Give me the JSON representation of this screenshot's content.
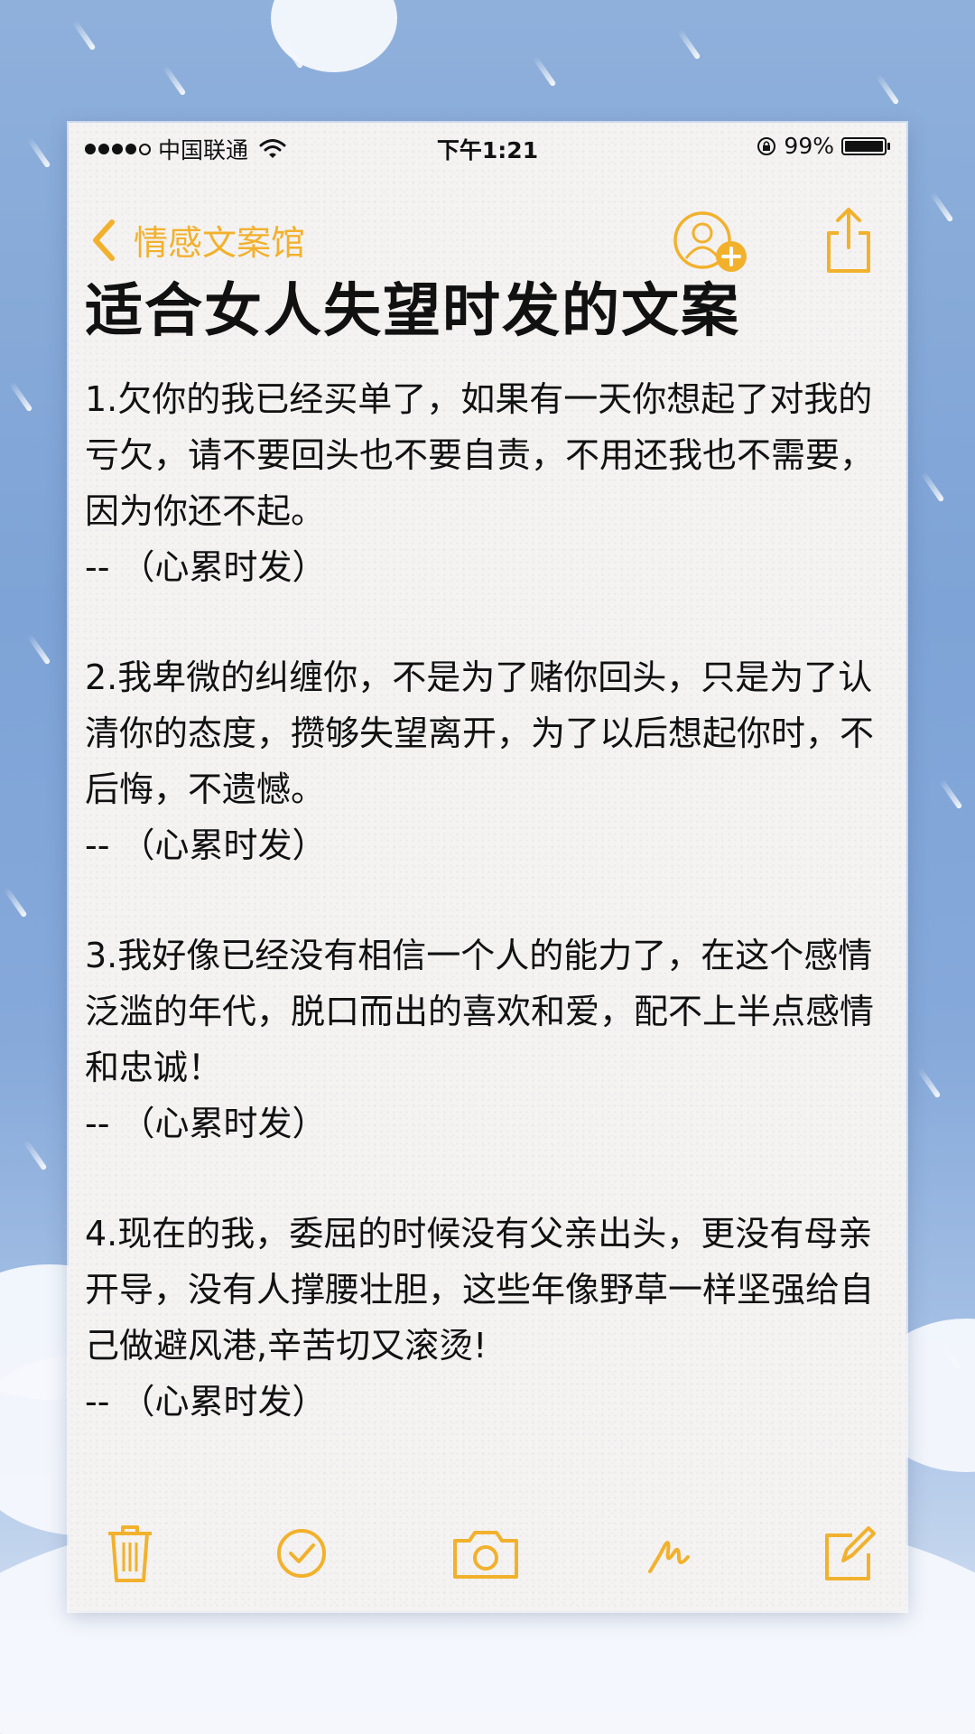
{
  "status_bar": {
    "carrier": "中国联通",
    "time": "下午1:21",
    "battery": "99%"
  },
  "nav": {
    "back_label": "情感文案馆"
  },
  "note": {
    "title": "适合女人失望时发的文案",
    "items": [
      {
        "text": "1.欠你的我已经买单了，如果有一天你想起了对我的亏欠，请不要回头也不要自责，不用还我也不需要，因为你还不起。",
        "signature": "-- （心累时发）"
      },
      {
        "text": "2.我卑微的纠缠你，不是为了赌你回头，只是为了认清你的态度，攒够失望离开，为了以后想起你时，不后悔，不遗憾。",
        "signature": "-- （心累时发）"
      },
      {
        "text": "3.我好像已经没有相信一个人的能力了，在这个感情泛滥的年代，脱口而出的喜欢和爱，配不上半点感情和忠诚！",
        "signature": "-- （心累时发）"
      },
      {
        "text": "4.现在的我，委屈的时候没有父亲出头，更没有母亲开导，没有人撑腰壮胆，这些年像野草一样坚强给自己做避风港,辛苦切又滚烫!",
        "signature": "-- （心累时发）"
      }
    ]
  },
  "theme": {
    "accent": "#f2b12d",
    "text": "#111111",
    "paper": "#f4f3f2",
    "background": "#7ea3d6"
  },
  "icons": {
    "toolbar": [
      "trash-icon",
      "checkmark-icon",
      "camera-icon",
      "sketch-icon",
      "compose-icon"
    ],
    "nav": [
      "chevron-left-icon",
      "add-person-icon",
      "share-icon"
    ]
  }
}
